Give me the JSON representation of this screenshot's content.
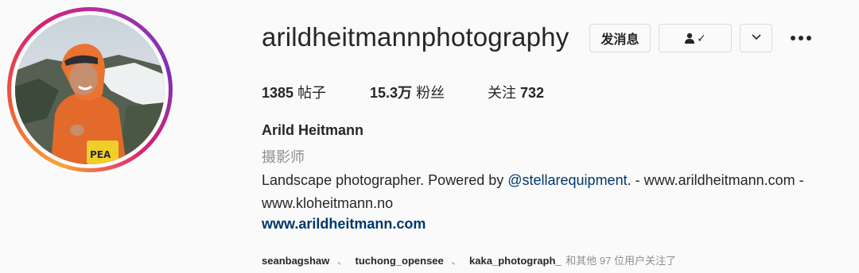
{
  "profile": {
    "username": "arildheitmannphotography",
    "message_button": "发消息",
    "follow_icon_check": "✓",
    "more_chevron": "⌄",
    "stats": {
      "posts_count": "1385",
      "posts_label": "帖子",
      "followers_count": "15.3万",
      "followers_label": "粉丝",
      "following_label": "关注",
      "following_count": "732"
    },
    "full_name": "Arild Heitmann",
    "category": "摄影师",
    "bio_prefix": "Landscape photographer. Powered by ",
    "bio_mention": "@stellarequipment",
    "bio_suffix": ". - www.arildheitmann.com -",
    "bio_line2": "www.kloheitmann.no",
    "website": "www.arildheitmann.com",
    "followed_by": {
      "users": [
        "seanbagshaw",
        "tuchong_opensee",
        "kaka_photograph_"
      ],
      "separator": "、",
      "suffix": "和其他 97 位用户关注了"
    }
  },
  "colors": {
    "text": "#262626",
    "muted": "#8e8e8e",
    "link": "#00376b",
    "border": "#dbdbdb",
    "background": "#fafafa"
  }
}
